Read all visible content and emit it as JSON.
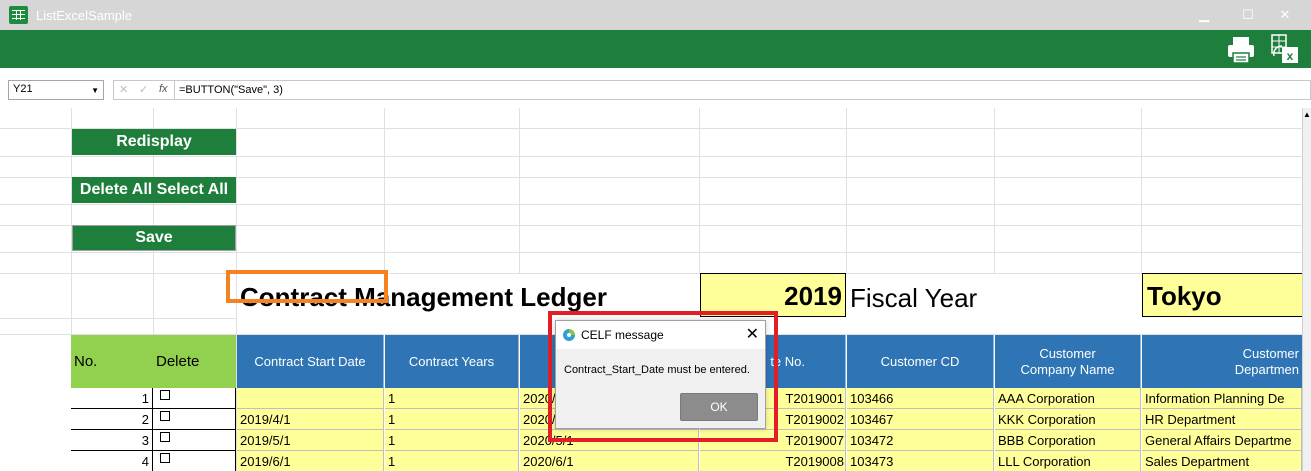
{
  "window": {
    "title": "ListExcelSample",
    "minimize": "▁",
    "maximize": "☐",
    "close": "✕"
  },
  "colors": {
    "ribbon_green": "#1e7e3b",
    "header_blue": "#2f75b5",
    "header_green": "#92d050",
    "input_yellow": "#ffff99",
    "highlight_orange": "#f58220",
    "highlight_red": "#e21e26"
  },
  "ribbon": {
    "icons": [
      "print-icon",
      "excel-close-icon"
    ]
  },
  "formula_bar": {
    "cell_ref": "Y21",
    "cancel_glyph": "✕",
    "enter_glyph": "✓",
    "fx_glyph": "fx",
    "formula": "=BUTTON(\"Save\", 3)"
  },
  "buttons": {
    "redisplay": "Redisplay",
    "delete_all_select_all": "Delete All Select All",
    "save": "Save"
  },
  "ledger": {
    "title": "Contract Management Ledger",
    "year": "2019",
    "fiscal_year_label": "Fiscal Year",
    "city": "Tokyo"
  },
  "table": {
    "headers": {
      "no": "No.",
      "delete": "Delete",
      "contract_start_date": "Contract Start Date",
      "contract_years": "Contract Years",
      "contract_no": "te No.",
      "customer_cd": "Customer CD",
      "customer_company_name_1": "Customer",
      "customer_company_name_2": "Company Name",
      "customer_department_1": "Customer",
      "customer_department_2": "Departmen"
    },
    "rows": [
      {
        "no": "1",
        "start": "",
        "years": "1",
        "end": "2020/",
        "contract_no": "T2019001",
        "customer_cd": "103466",
        "company": "AAA Corporation",
        "department": "Information Planning De"
      },
      {
        "no": "2",
        "start": "2019/4/1",
        "years": "1",
        "end": "2020/",
        "contract_no": "T2019002",
        "customer_cd": "103467",
        "company": "KKK Corporation",
        "department": "HR Department"
      },
      {
        "no": "3",
        "start": "2019/5/1",
        "years": "1",
        "end": "2020/5/1",
        "contract_no": "T2019007",
        "customer_cd": "103472",
        "company": "BBB Corporation",
        "department": "General Affairs Departme"
      },
      {
        "no": "4",
        "start": "2019/6/1",
        "years": "1",
        "end": "2020/6/1",
        "contract_no": "T2019008",
        "customer_cd": "103473",
        "company": "LLL Corporation",
        "department": "Sales Department"
      }
    ]
  },
  "dialog": {
    "title": "CELF message",
    "message": "Contract_Start_Date must be entered.",
    "ok_label": "OK",
    "close_glyph": "✕"
  }
}
